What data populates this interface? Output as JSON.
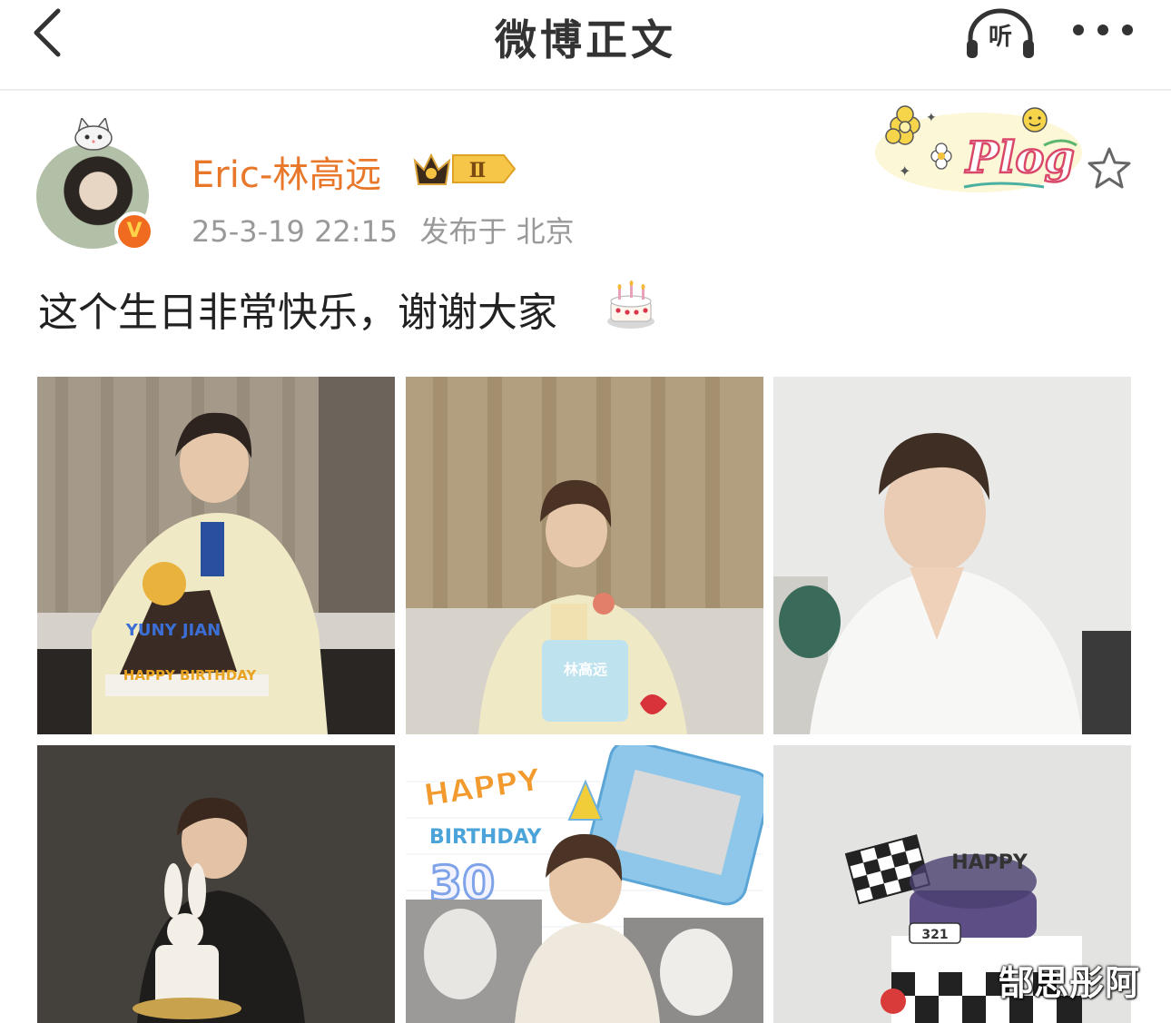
{
  "header": {
    "title": "微博正文",
    "listen_label": "听"
  },
  "post": {
    "username": "Eric-林高远",
    "vip_level": "Ⅱ",
    "verified_mark": "V",
    "timestamp": "25-3-19 22:15",
    "location": "发布于 北京",
    "sticker_text": "Plog",
    "text": "这个生日非常快乐，谢谢大家"
  },
  "photos": {
    "p1_cake_text": "YUNY JIAN",
    "p1_banner": "HAPPY BIRTHDAY",
    "p2_cake_text": "林高远",
    "p5_happy": "HAPPY",
    "p5_birthday": "BIRTHDAY",
    "p5_number": "30",
    "p6_happy": "HAPPY",
    "p6_plate": "321"
  },
  "watermark": "郜思彤阿",
  "colors": {
    "username": "#e8772a",
    "meta": "#999999",
    "verified_badge": "#f06a1f"
  }
}
